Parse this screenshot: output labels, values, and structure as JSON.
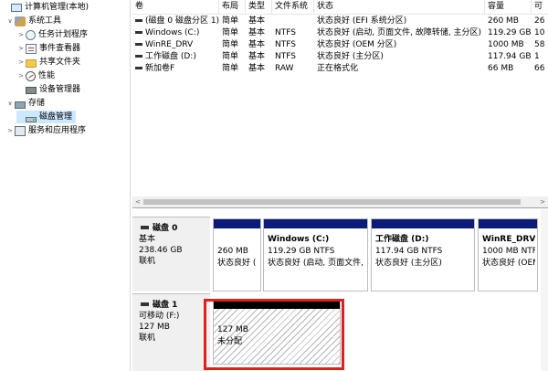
{
  "tree": [
    {
      "id": "root",
      "label": "计算机管理(本地)",
      "icon": "computer-icon",
      "expander": ""
    },
    {
      "id": "system-tools",
      "label": "系统工具",
      "icon": "tools-icon",
      "expander": "∨"
    },
    {
      "id": "task-scheduler",
      "label": "任务计划程序",
      "icon": "clock-icon",
      "expander": ">"
    },
    {
      "id": "event-viewer",
      "label": "事件查看器",
      "icon": "event-viewer-icon",
      "expander": ">"
    },
    {
      "id": "shared-folders",
      "label": "共享文件夹",
      "icon": "shared-folder-icon",
      "expander": ">"
    },
    {
      "id": "performance",
      "label": "性能",
      "icon": "performance-icon",
      "expander": ">"
    },
    {
      "id": "device-manager",
      "label": "设备管理器",
      "icon": "device-manager-icon",
      "expander": ""
    },
    {
      "id": "storage",
      "label": "存储",
      "icon": "storage-icon",
      "expander": "∨"
    },
    {
      "id": "disk-management",
      "label": "磁盘管理",
      "icon": "disk-icon",
      "expander": "",
      "selected": true
    },
    {
      "id": "services",
      "label": "服务和应用程序",
      "icon": "services-icon",
      "expander": ">"
    }
  ],
  "volumes": {
    "columns": [
      "卷",
      "布局",
      "类型",
      "文件系统",
      "状态",
      "容量",
      "可"
    ],
    "rows": [
      [
        "(磁盘 0 磁盘分区 1)",
        "简单",
        "基本",
        "",
        "状态良好 (EFI 系统分区)",
        "260 MB",
        "26"
      ],
      [
        "Windows (C:)",
        "简单",
        "基本",
        "NTFS",
        "状态良好 (启动, 页面文件, 故障转储, 主分区)",
        "119.29 GB",
        "10"
      ],
      [
        "WinRE_DRV",
        "简单",
        "基本",
        "NTFS",
        "状态良好 (OEM 分区)",
        "1000 MB",
        "58"
      ],
      [
        "工作磁盘 (D:)",
        "简单",
        "基本",
        "NTFS",
        "状态良好 (主分区)",
        "117.94 GB",
        "1"
      ],
      [
        "新加卷F",
        "简单",
        "基本",
        "RAW",
        "正在格式化",
        "66 MB",
        "66"
      ]
    ],
    "scroll_left": "<",
    "scroll_right": ">"
  },
  "disks": {
    "disk0": {
      "name": "磁盘 0",
      "type": "基本",
      "size": "238.46 GB",
      "status": "联机",
      "partitions": [
        {
          "title": "",
          "size": "260 MB",
          "status": "状态良好 ("
        },
        {
          "title": "Windows  (C:)",
          "size": "119.29 GB NTFS",
          "status": "状态良好 (启动, 页面文件,"
        },
        {
          "title": "工作磁盘  (D:)",
          "size": "117.94 GB NTFS",
          "status": "状态良好 (主分区)"
        },
        {
          "title": "WinRE_DRV",
          "size": "1000 MB NTFS",
          "status": "状态良好 (OEM"
        }
      ]
    },
    "disk1": {
      "name": "磁盘 1",
      "type": "可移动 (F:)",
      "size": "127 MB",
      "status": "联机",
      "partition": {
        "size": "127 MB",
        "status": "未分配"
      }
    }
  },
  "colors": {
    "primary_partition_bar": "#0c1a7a",
    "selection": "#cce8ff",
    "highlight_box": "#e02020"
  }
}
